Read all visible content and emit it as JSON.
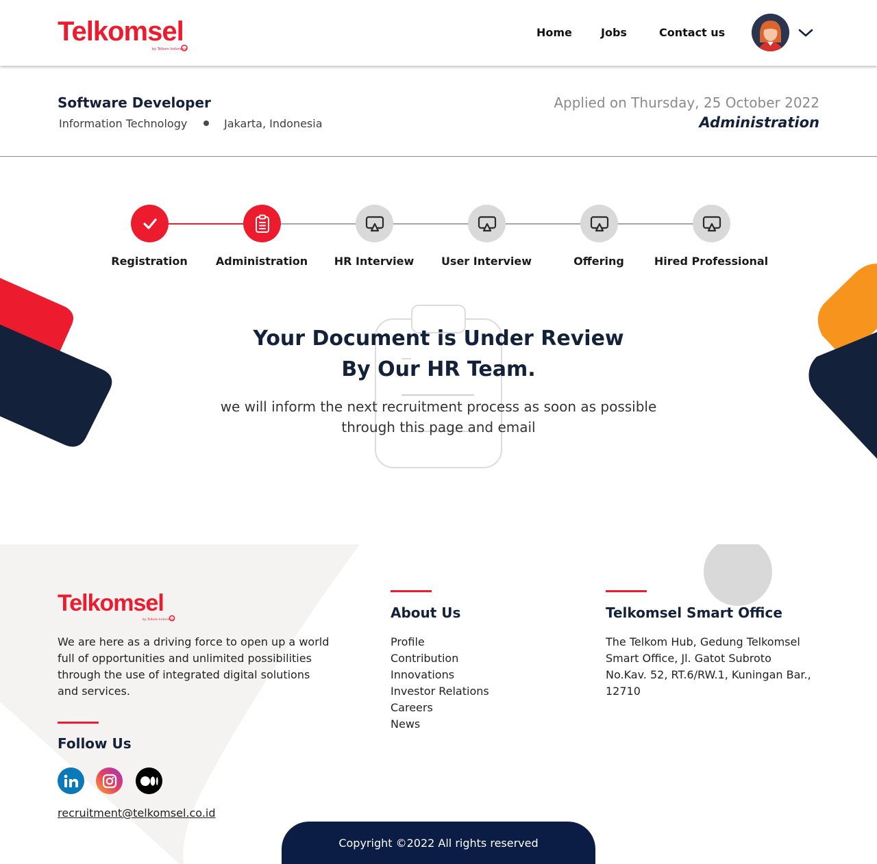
{
  "brand": {
    "name": "Telkomsel",
    "sub": "by Telkom Indonesia",
    "primary_color": "#ec1c2e",
    "navy_color": "#13213a"
  },
  "nav": {
    "home": "Home",
    "jobs": "Jobs",
    "contact": "Contact us"
  },
  "job": {
    "title": "Software Developer",
    "department": "Information Technology",
    "location": "Jakarta, Indonesia",
    "applied": "Applied on Thursday, 25 October 2022",
    "stage": "Administration"
  },
  "steps": [
    {
      "label": "Registration",
      "status": "done",
      "icon": "check-icon"
    },
    {
      "label": "Administration",
      "status": "current",
      "icon": "clipboard-icon"
    },
    {
      "label": "HR Interview",
      "status": "pending",
      "icon": "screen-cast-icon"
    },
    {
      "label": "User Interview",
      "status": "pending",
      "icon": "screen-cast-icon"
    },
    {
      "label": "Offering",
      "status": "pending",
      "icon": "screen-cast-icon"
    },
    {
      "label": "Hired Professional",
      "status": "pending",
      "icon": "screen-cast-icon"
    }
  ],
  "message": {
    "title_line1": "Your Document is Under Review",
    "title_line2": "By Our HR Team.",
    "body_line1": "we will inform the next recruitment process as soon as possible",
    "body_line2": "through this page and email"
  },
  "footer": {
    "description": "We are here as a driving force to open up a world full of opportunities and unlimited possibilities through the use of integrated digital solutions and services.",
    "follow_heading": "Follow Us",
    "social": [
      "linkedin-icon",
      "instagram-icon",
      "medium-icon"
    ],
    "email": "recruitment@telkomsel.co.id",
    "about_heading": "About Us",
    "about_links": [
      "Profile",
      "Contribution",
      "Innovations",
      "Investor Relations",
      "Careers",
      "News"
    ],
    "office_heading": "Telkomsel Smart Office",
    "office_address": "The Telkom Hub, Gedung Telkomsel Smart Office, Jl. Gatot Subroto No.Kav. 52, RT.6/RW.1, Kuningan Bar., 12710",
    "copyright": "Copyright ©2022 All rights reserved"
  }
}
